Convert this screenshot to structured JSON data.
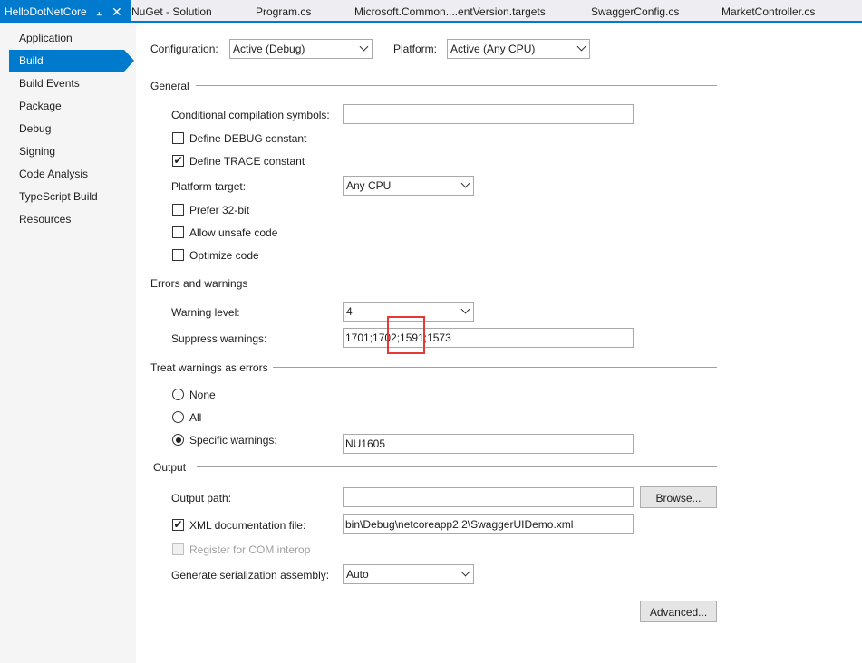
{
  "tabs": [
    {
      "label": "HelloDotNetCore",
      "active": true
    },
    {
      "label": "NuGet - Solution"
    },
    {
      "label": "Program.cs"
    },
    {
      "label": "Microsoft.Common....entVersion.targets"
    },
    {
      "label": "SwaggerConfig.cs"
    },
    {
      "label": "MarketController.cs"
    }
  ],
  "tab_icons": {
    "pin": "pin-icon",
    "close": "close-icon"
  },
  "sidebar": {
    "items": [
      {
        "label": "Application"
      },
      {
        "label": "Build",
        "active": true
      },
      {
        "label": "Build Events"
      },
      {
        "label": "Package"
      },
      {
        "label": "Debug"
      },
      {
        "label": "Signing"
      },
      {
        "label": "Code Analysis"
      },
      {
        "label": "TypeScript Build"
      },
      {
        "label": "Resources"
      }
    ]
  },
  "top": {
    "configuration_label": "Configuration:",
    "configuration_value": "Active (Debug)",
    "platform_label": "Platform:",
    "platform_value": "Active (Any CPU)"
  },
  "general": {
    "title": "General",
    "conditional_symbols_label": "Conditional compilation symbols:",
    "conditional_symbols_value": "",
    "define_debug_label": "Define DEBUG constant",
    "define_debug_checked": false,
    "define_trace_label": "Define TRACE constant",
    "define_trace_checked": true,
    "platform_target_label": "Platform target:",
    "platform_target_value": "Any CPU",
    "prefer32_label": "Prefer 32-bit",
    "allow_unsafe_label": "Allow unsafe code",
    "optimize_label": "Optimize code"
  },
  "errors": {
    "title": "Errors and warnings",
    "warning_level_label": "Warning level:",
    "warning_level_value": "4",
    "suppress_label": "Suppress warnings:",
    "suppress_value": "1701;1702;1591;1573"
  },
  "treat": {
    "title": "Treat warnings as errors",
    "none_label": "None",
    "all_label": "All",
    "specific_label": "Specific warnings:",
    "specific_value": "NU1605",
    "selected": "specific"
  },
  "output": {
    "title": "Output",
    "path_label": "Output path:",
    "path_value": "",
    "browse_label": "Browse...",
    "xml_label": "XML documentation file:",
    "xml_checked": true,
    "xml_value": "bin\\Debug\\netcoreapp2.2\\SwaggerUIDemo.xml",
    "com_label": "Register for COM interop",
    "serialization_label": "Generate serialization assembly:",
    "serialization_value": "Auto",
    "advanced_label": "Advanced..."
  },
  "colors": {
    "accent": "#007acc",
    "highlight": "#e53935",
    "sidebar_bg": "#f5f5f5",
    "tabbar_bg": "#eeeef2"
  }
}
